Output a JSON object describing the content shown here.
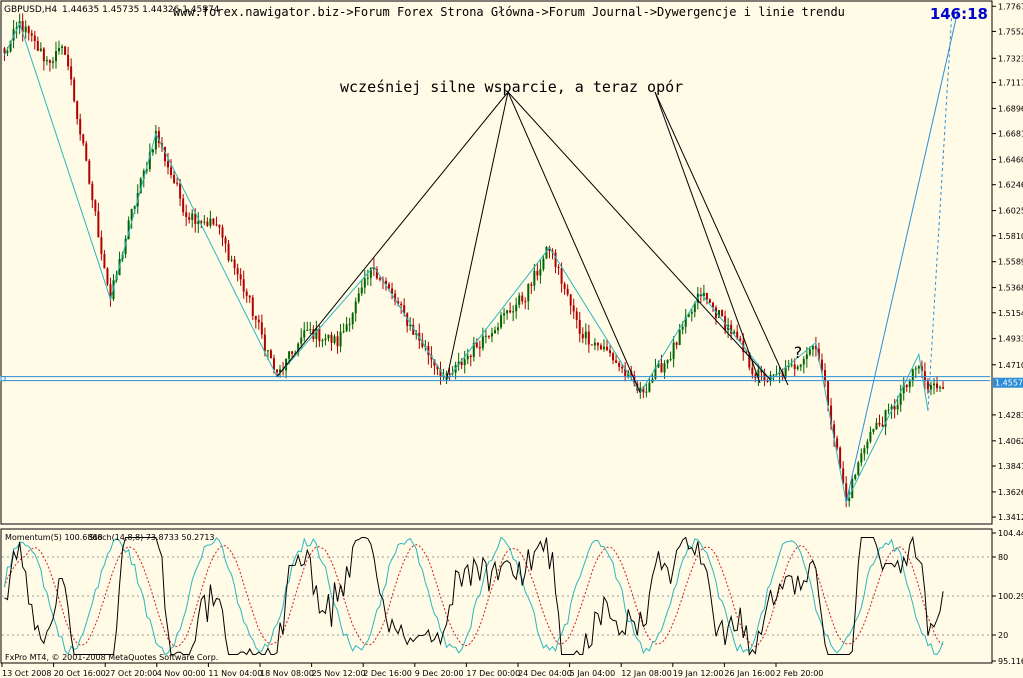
{
  "symbol_info": {
    "symbol": "GBPUSD,H4",
    "ohlc": "1.44635 1.45735 1.44326 1.45574"
  },
  "breadcrumb": "www.forex.nawigator.biz->Forum Forex Strona Główna->Forum Journal->Dywergencje i linie trendu",
  "countdown": "146:18",
  "annotation_text": "wcześniej silne wsparcie, a teraz opór",
  "question_mark": "?",
  "current_price_label": "1.45574",
  "indicator_label": {
    "momentum": "Momentum(5) 100.6868",
    "stoch": "Stoch(14,8,8) 73.8733 50.2713"
  },
  "copyright": "FxPro MT4, © 2001-2008 MetaQuotes Software Corp.",
  "colors": {
    "background": "#fffbe6",
    "candle_up": "#006400",
    "candle_down": "#b00000",
    "zigzag": "#2bb7c0",
    "trendline": "#2c8ed8",
    "support_line": "#2c8ed8",
    "stoch_main": "#2bb7c0",
    "stoch_signal": "#d02020",
    "momentum": "#000000",
    "countdown": "#0000cc"
  },
  "chart_data": {
    "type": "candlestick",
    "symbol": "GBPUSD",
    "timeframe": "H4",
    "y_axis_ticks": [
      "1.77670",
      "1.75525",
      "1.73235",
      "1.71170",
      "1.68960",
      "1.66815",
      "1.64605",
      "1.62460",
      "1.60250",
      "1.58105",
      "1.55895",
      "1.53685",
      "1.51540",
      "1.49330",
      "1.47105",
      "1.42830",
      "1.40620",
      "1.38475",
      "1.36265",
      "1.34120"
    ],
    "x_axis_ticks": [
      "13 Oct 2008",
      "20 Oct 16:00",
      "27 Oct 20:00",
      "4 Nov 00:00",
      "11 Nov 04:00",
      "18 Nov 08:00",
      "25 Nov 12:00",
      "2 Dec 16:00",
      "9 Dec 20:00",
      "17 Dec 00:00",
      "24 Dec 04:00",
      "5 Jan 04:00",
      "12 Jan 08:00",
      "19 Jan 12:00",
      "26 Jan 16:00",
      "2 Feb 20:00"
    ],
    "ylim": [
      1.3412,
      1.7767
    ],
    "support_level": 1.4592,
    "last_close": 1.45574,
    "zigzag_points": [
      {
        "bar": 0,
        "price": 1.735
      },
      {
        "bar": 5,
        "price": 1.762
      },
      {
        "bar": 35,
        "price": 1.527
      },
      {
        "bar": 50,
        "price": 1.668
      },
      {
        "bar": 90,
        "price": 1.461
      },
      {
        "bar": 122,
        "price": 1.555
      },
      {
        "bar": 146,
        "price": 1.458
      },
      {
        "bar": 180,
        "price": 1.571
      },
      {
        "bar": 210,
        "price": 1.447
      },
      {
        "bar": 230,
        "price": 1.532
      },
      {
        "bar": 253,
        "price": 1.458
      },
      {
        "bar": 268,
        "price": 1.49
      },
      {
        "bar": 278,
        "price": 1.354
      },
      {
        "bar": 293,
        "price": 1.432
      },
      {
        "bar": 302,
        "price": 1.48
      },
      {
        "bar": 305,
        "price": 1.432
      }
    ],
    "candles_key_path": [
      {
        "bar": 0,
        "price": 1.735
      },
      {
        "bar": 5,
        "price": 1.762
      },
      {
        "bar": 14,
        "price": 1.73
      },
      {
        "bar": 20,
        "price": 1.74
      },
      {
        "bar": 35,
        "price": 1.527
      },
      {
        "bar": 42,
        "price": 1.6
      },
      {
        "bar": 50,
        "price": 1.668
      },
      {
        "bar": 60,
        "price": 1.6
      },
      {
        "bar": 70,
        "price": 1.59
      },
      {
        "bar": 80,
        "price": 1.53
      },
      {
        "bar": 90,
        "price": 1.461
      },
      {
        "bar": 100,
        "price": 1.5
      },
      {
        "bar": 110,
        "price": 1.49
      },
      {
        "bar": 122,
        "price": 1.555
      },
      {
        "bar": 135,
        "price": 1.5
      },
      {
        "bar": 146,
        "price": 1.458
      },
      {
        "bar": 160,
        "price": 1.5
      },
      {
        "bar": 172,
        "price": 1.53
      },
      {
        "bar": 180,
        "price": 1.571
      },
      {
        "bar": 190,
        "price": 1.5
      },
      {
        "bar": 200,
        "price": 1.48
      },
      {
        "bar": 210,
        "price": 1.447
      },
      {
        "bar": 220,
        "price": 1.48
      },
      {
        "bar": 230,
        "price": 1.532
      },
      {
        "bar": 240,
        "price": 1.5
      },
      {
        "bar": 248,
        "price": 1.463
      },
      {
        "bar": 253,
        "price": 1.458
      },
      {
        "bar": 260,
        "price": 1.468
      },
      {
        "bar": 268,
        "price": 1.49
      },
      {
        "bar": 272,
        "price": 1.44
      },
      {
        "bar": 278,
        "price": 1.354
      },
      {
        "bar": 285,
        "price": 1.41
      },
      {
        "bar": 293,
        "price": 1.432
      },
      {
        "bar": 302,
        "price": 1.47
      },
      {
        "bar": 305,
        "price": 1.45
      },
      {
        "bar": 310,
        "price": 1.456
      }
    ],
    "indicator": {
      "momentum_period": 5,
      "momentum_value": 100.6868,
      "stoch_params": "14,8,8",
      "stoch_main": 73.8733,
      "stoch_signal": 50.2713,
      "y_ticks": [
        "104.448",
        "80",
        "100.2988",
        "20",
        "95.1165"
      ]
    }
  }
}
